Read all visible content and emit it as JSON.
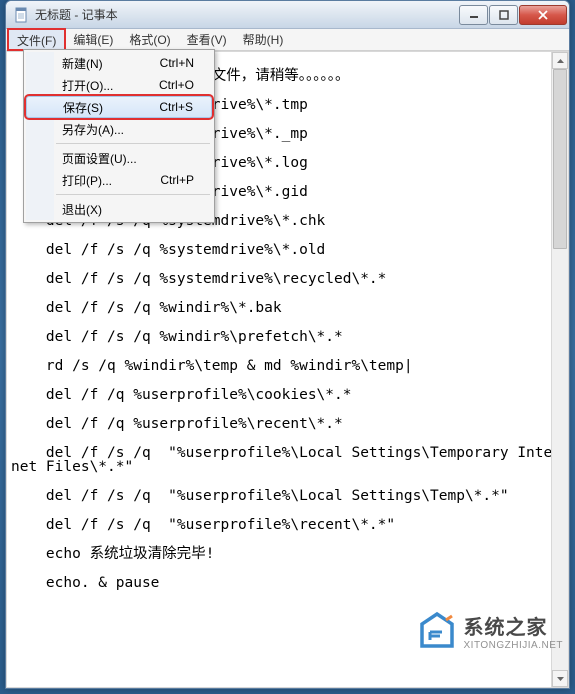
{
  "titlebar": {
    "title": "无标题 - 记事本"
  },
  "menubar": {
    "file": "文件(F)",
    "edit": "编辑(E)",
    "format": "格式(O)",
    "view": "查看(V)",
    "help": "帮助(H)"
  },
  "file_menu": {
    "new": {
      "label": "新建(N)",
      "shortcut": "Ctrl+N"
    },
    "open": {
      "label": "打开(O)...",
      "shortcut": "Ctrl+O"
    },
    "save": {
      "label": "保存(S)",
      "shortcut": "Ctrl+S"
    },
    "save_as": {
      "label": "另存为(A)...",
      "shortcut": ""
    },
    "page_setup": {
      "label": "页面设置(U)...",
      "shortcut": ""
    },
    "print": {
      "label": "打印(P)...",
      "shortcut": "Ctrl+P"
    },
    "exit": {
      "label": "退出(X)",
      "shortcut": ""
    }
  },
  "editor": {
    "text": "\n                       文件，请稍等。。。。。。\n\n                       rive%\\*.tmp\n\n                       rive%\\*._mp\n\n                       rive%\\*.log\n\n                       rive%\\*.gid\n\n    del /f /s /q %systemdrive%\\*.chk\n\n    del /f /s /q %systemdrive%\\*.old\n\n    del /f /s /q %systemdrive%\\recycled\\*.*\n\n    del /f /s /q %windir%\\*.bak\n\n    del /f /s /q %windir%\\prefetch\\*.*\n\n    rd /s /q %windir%\\temp & md %windir%\\temp|\n\n    del /f /q %userprofile%\\cookies\\*.*\n\n    del /f /q %userprofile%\\recent\\*.*\n\n    del /f /s /q  \"%userprofile%\\Local Settings\\Temporary Internet Files\\*.*\"\n\n    del /f /s /q  \"%userprofile%\\Local Settings\\Temp\\*.*\"\n\n    del /f /s /q  \"%userprofile%\\recent\\*.*\"\n\n    echo 系统垃圾清除完毕!\n\n    echo. & pause"
  },
  "watermark": {
    "cn": "系统之家",
    "en": "XITONGZHIJIA.NET"
  }
}
